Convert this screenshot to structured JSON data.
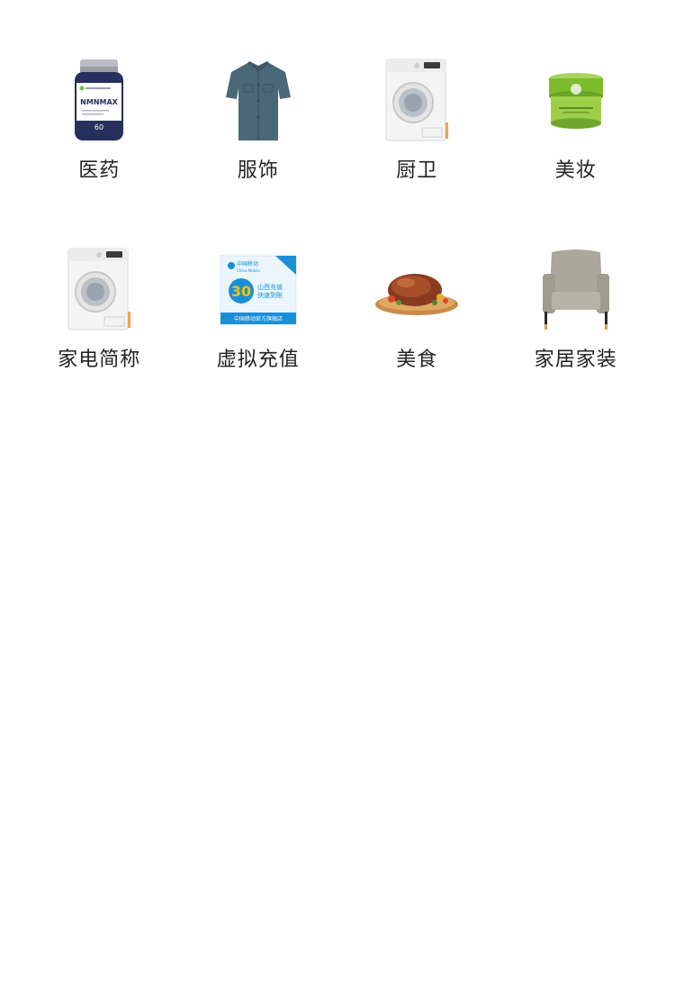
{
  "categories": [
    {
      "label": "医药",
      "icon": "supplement-bottle-icon"
    },
    {
      "label": "服饰",
      "icon": "shirt-icon"
    },
    {
      "label": "厨卫",
      "icon": "washing-machine-icon"
    },
    {
      "label": "美妆",
      "icon": "cream-jar-icon"
    },
    {
      "label": "家电简称",
      "icon": "washing-machine-icon"
    },
    {
      "label": "虚拟充值",
      "icon": "recharge-card-icon"
    },
    {
      "label": "美食",
      "icon": "roast-dish-icon"
    },
    {
      "label": "家居家装",
      "icon": "armchair-icon"
    }
  ],
  "product_text": {
    "bottle_brand": "NMNMAX",
    "bottle_count": "60",
    "card_amount": "30",
    "card_brand": "中国移动",
    "card_brand_en": "China Mobile",
    "card_title": "山西充值",
    "card_sub": "快速到账",
    "card_footer": "中国移动官方旗舰店"
  },
  "colors": {
    "text": "#222222",
    "background": "#ffffff",
    "mobile_blue": "#1a8fd8",
    "cream_green": "#8cc63f"
  }
}
